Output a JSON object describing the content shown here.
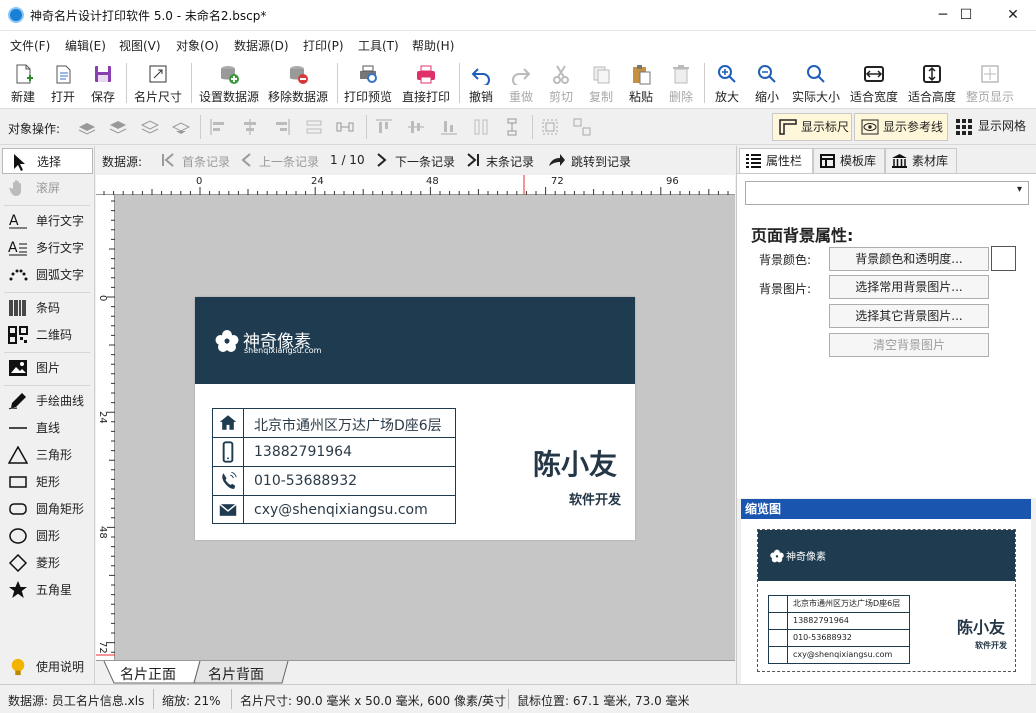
{
  "window": {
    "title": "神奇名片设计打印软件 5.0 - 未命名2.bscp*",
    "minimize": "─",
    "maximize": "☐",
    "close": "✕"
  },
  "menu": [
    "文件(F)",
    "编辑(E)",
    "视图(V)",
    "对象(O)",
    "数据源(D)",
    "打印(P)",
    "工具(T)",
    "帮助(H)"
  ],
  "toolbar": {
    "new": "新建",
    "open": "打开",
    "save": "保存",
    "card_size": "名片尺寸",
    "set_datasource": "设置数据源",
    "remove_datasource": "移除数据源",
    "print_preview": "打印预览",
    "direct_print": "直接打印",
    "undo": "撤销",
    "redo": "重做",
    "cut": "剪切",
    "copy": "复制",
    "paste": "粘贴",
    "delete": "删除",
    "zoom_in": "放大",
    "zoom_out": "缩小",
    "actual_size": "实际大小",
    "fit_width": "适合宽度",
    "fit_height": "适合高度",
    "fit_page": "整页显示"
  },
  "toolbar2": {
    "label": "对象操作:",
    "show_ruler": "显示标尺",
    "show_guides": "显示参考线",
    "show_grid": "显示网格"
  },
  "left_tools": {
    "select": "选择",
    "scroll": "滚屏",
    "single_text": "单行文字",
    "multi_text": "多行文字",
    "arc_text": "圆弧文字",
    "barcode": "条码",
    "qrcode": "二维码",
    "image": "图片",
    "freehand": "手绘曲线",
    "line": "直线",
    "triangle": "三角形",
    "rect": "矩形",
    "round_rect": "圆角矩形",
    "circle": "圆形",
    "diamond": "菱形",
    "star": "五角星",
    "help": "使用说明"
  },
  "navbar": {
    "label": "数据源:",
    "first": "首条记录",
    "prev": "上一条记录",
    "position": "1 / 10",
    "next": "下一条记录",
    "last": "末条记录",
    "goto": "跳转到记录"
  },
  "ruler": {
    "h_ticks": [
      "0",
      "24",
      "48",
      "72",
      "96"
    ],
    "v_ticks": [
      "0",
      "24",
      "48",
      "72"
    ]
  },
  "card": {
    "logo_name": "神奇像素",
    "logo_url": "shenqixiangsu.com",
    "name": "陈小友",
    "job_title": "软件开发",
    "address": "北京市通州区万达广场D座6层",
    "mobile": "13882791964",
    "phone": "010-53688932",
    "email": "cxy@shenqixiangsu.com",
    "band_color": "#1f3b50"
  },
  "bottom_tabs": {
    "front": "名片正面",
    "back": "名片背面"
  },
  "statusbar": {
    "datasource": "数据源: 员工名片信息.xls",
    "zoom": "缩放: 21%",
    "card_size": "名片尺寸: 90.0 毫米 x 50.0 毫米, 600 像素/英寸",
    "mouse": "鼠标位置: 67.1 毫米, 73.0 毫米"
  },
  "right_panel": {
    "tabs": [
      "属性栏",
      "模板库",
      "素材库"
    ],
    "section_title": "页面背景属性:",
    "bg_color_label": "背景颜色:",
    "bg_color_button": "背景颜色和透明度...",
    "bg_image_label": "背景图片:",
    "common_bg_button": "选择常用背景图片...",
    "other_bg_button": "选择其它背景图片...",
    "clear_bg_button": "清空背景图片",
    "thumbnail_title": "缩览图"
  }
}
